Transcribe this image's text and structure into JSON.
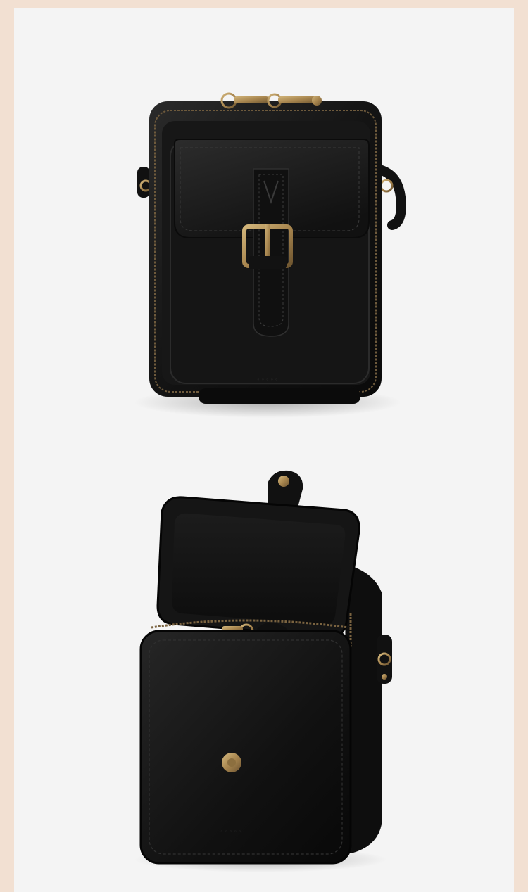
{
  "page": {
    "frame_color": "#f2e0d2",
    "panel_color": "#f4f4f4"
  },
  "images": [
    {
      "view": "closed-front",
      "subject": "black leather crossbody phone bag with front flap and brass buckle",
      "leather_color": "#141414",
      "hardware_color": "#a8864f",
      "brand_mark": "brand-logo-embossed"
    },
    {
      "view": "open-flap",
      "subject": "black leather crossbody phone bag with flap raised showing magnetic snap",
      "leather_color": "#141414",
      "hardware_color": "#a8864f",
      "brand_mark": "brand-logo-embossed"
    }
  ]
}
